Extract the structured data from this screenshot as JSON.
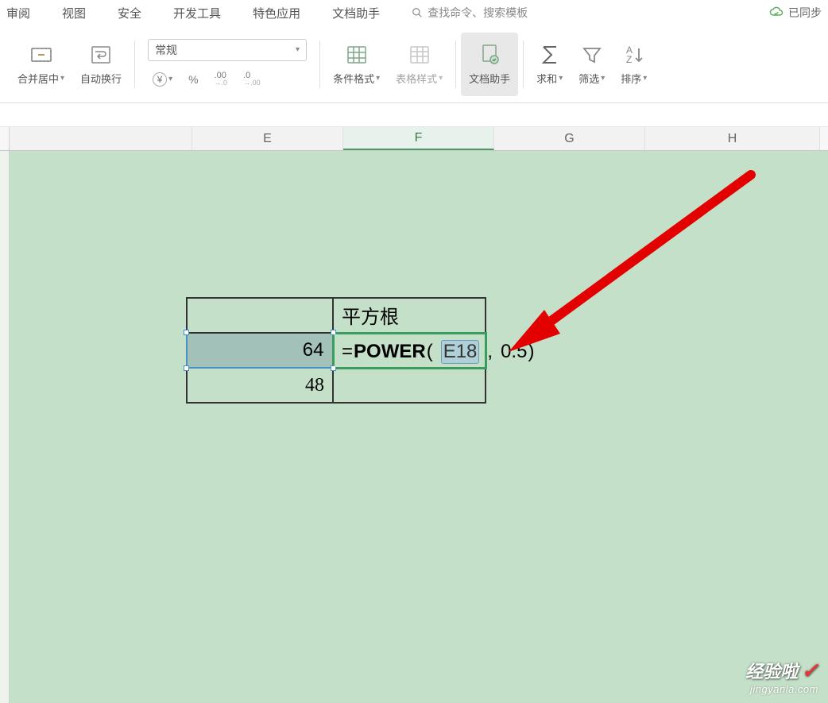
{
  "menubar": {
    "items": [
      "审阅",
      "视图",
      "安全",
      "开发工具",
      "特色应用",
      "文档助手"
    ],
    "search_placeholder": "查找命令、搜索模板",
    "sync_label": "已同步"
  },
  "ribbon": {
    "merge": {
      "label": "合并居中"
    },
    "wrap": {
      "label": "自动换行"
    },
    "format_select": "常规",
    "currency_icon": "¥",
    "percent_icon": "%",
    "decimal_inc": ".00",
    "decimal_dec": ".0",
    "decimal_inc_sub": "→.0",
    "decimal_dec_sub": "→.00",
    "cond_format": {
      "label": "条件格式"
    },
    "table_style": {
      "label": "表格样式"
    },
    "doc_assist": {
      "label": "文档助手"
    },
    "sum": {
      "label": "求和"
    },
    "filter": {
      "label": "筛选"
    },
    "sort": {
      "label": "排序"
    }
  },
  "columns": [
    "E",
    "F",
    "G",
    "H"
  ],
  "active_column_index": 1,
  "table": {
    "header": "平方根",
    "row1_value": "64",
    "row2_value": "48"
  },
  "formula": {
    "prefix": "=",
    "func": "POWER",
    "open": "(",
    "ref": "E18",
    "sep": ",",
    "arg2": "0.5",
    "close": ")"
  },
  "watermark": {
    "line1": "经验啦",
    "line2": "jingyanla.com"
  }
}
